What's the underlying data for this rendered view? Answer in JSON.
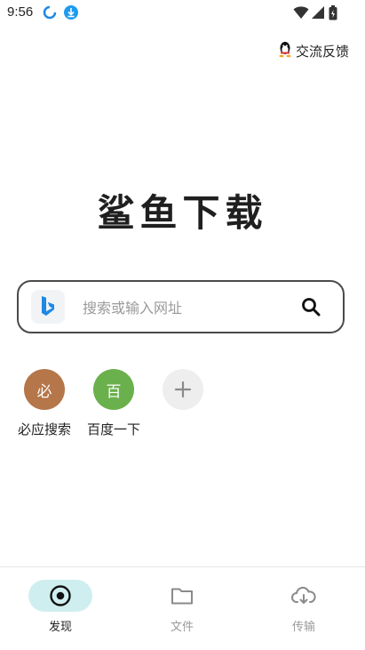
{
  "status_bar": {
    "time": "9:56"
  },
  "header": {
    "feedback_label": "交流反馈"
  },
  "app": {
    "title": "鲨鱼下载"
  },
  "search": {
    "placeholder": "搜索或输入网址"
  },
  "shortcuts": [
    {
      "label": "必应搜索",
      "glyph": "必",
      "color": "#b5764a"
    },
    {
      "label": "百度一下",
      "glyph": "百",
      "color": "#6ab04c"
    },
    {
      "glyph": "+"
    }
  ],
  "bottom_nav": [
    {
      "label": "发现",
      "icon": "discover-icon",
      "active": true
    },
    {
      "label": "文件",
      "icon": "folder-icon",
      "active": false
    },
    {
      "label": "传输",
      "icon": "cloud-download-icon",
      "active": false
    }
  ],
  "colors": {
    "accent": "#cfeef0",
    "bing_blue": "#1e88e5"
  }
}
